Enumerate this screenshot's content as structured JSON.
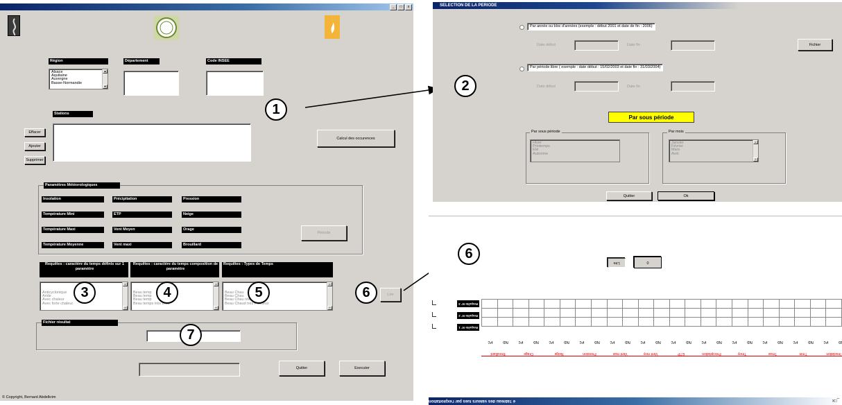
{
  "main_window": {
    "title": "",
    "controls": [
      "_",
      "□",
      "x"
    ],
    "region_label": "Région",
    "region_items": [
      "Alsace",
      "Aquitaine",
      "Auvergne",
      "Basse-Normandie"
    ],
    "department_label": "Département",
    "insee_label": "Code INSEE",
    "stations_label": "Stations",
    "buttons": {
      "effacer": "Effacer",
      "ajouter": "Ajouter",
      "supprimer": "Supprimer",
      "calcul": "Calcul des occurences",
      "periode": "Période",
      "quitter": "Quitter",
      "executer": "Executer",
      "lire": "Lire"
    },
    "params_title": "Paramètres Météorologiques",
    "params": [
      [
        "Insolation",
        "Précipitation",
        "Pression"
      ],
      [
        "Température Mini",
        "ETP",
        "Neige"
      ],
      [
        "Température Maxi",
        "Vent Moyen",
        "Orage"
      ],
      [
        "Température Moyenne",
        "Vent maxi",
        "Brouillard"
      ]
    ],
    "req1_label": "Requêtes : caractère du temps définis sur 1 paramètre",
    "req1_items": [
      "Anticyclonique",
      "Aride",
      "Avec chaleur",
      "Avec forte chaleur"
    ],
    "req2_label": "Requêtes : caractère du temps composition de paramètre",
    "req2_items": [
      "Beau temp",
      "Beau temp",
      "Beau temp",
      "Beau temps très froid"
    ],
    "req3_label": "Requêtes : Types de Temps",
    "req3_items": [
      "Beau Chau",
      "Beau Chau",
      "Beau Chau                 ntieux",
      "Beau Chaud très Pluvieux"
    ],
    "fichier_label": "Fichier résultat",
    "copyright": "© Copyright, Bernard Abdelkrim"
  },
  "annotations": {
    "n1": "1",
    "n2": "2",
    "n3": "3",
    "n4": "4",
    "n5": "5",
    "n6a": "6",
    "n6b": "6",
    "n7": "7"
  },
  "period_window": {
    "title": "SELECTION DE LA PERIODE",
    "option1": "Par année ou bloc d'années (exemple : début 2001 et date de fin : 2006)",
    "option2": "Par période libre ( exemple : date début : 15/02/2003 et date fin : 31/03/2004)",
    "date_debut": "Date début",
    "date_fin": "Date fin",
    "fichier_btn": "Fichier",
    "par_sous_periode_btn": "Par sous période",
    "group_sous_periode": "Par sous période",
    "sous_periode_items": [
      "Hiver",
      "Printemps",
      "Eté",
      "Automne"
    ],
    "group_mois": "Par mois",
    "mois_items": [
      "Janvier",
      "Février",
      "Mars",
      "Avril"
    ],
    "quitter_btn": "Quitter",
    "ok_btn": "Ok"
  },
  "result_window": {
    "title": "e Tableau des valeurs lues par l'exploitation",
    "btn_a": "Lire",
    "btn_b": "0",
    "rows": [
      "Requête N° 3",
      "Requête N° 2",
      "Requête N° 1"
    ],
    "pairs": [
      [
        "Nb",
        "Pc"
      ],
      [
        "Nb",
        "Pc"
      ],
      [
        "Nb",
        "Pc"
      ],
      [
        "Nb",
        "Pc"
      ],
      [
        "Nb",
        "Pc"
      ],
      [
        "Nb",
        "Pc"
      ],
      [
        "Nb",
        "Pc"
      ],
      [
        "Nb",
        "Pc"
      ],
      [
        "Nb",
        "Pc"
      ],
      [
        "Nb",
        "Pc"
      ],
      [
        "Nb",
        "Pc"
      ],
      [
        "Nb",
        "Pc"
      ]
    ],
    "columns": [
      "Insolation",
      "Tmin",
      "Tmax",
      "Tmoy",
      "Précipitation",
      "ETP",
      "Vent moy",
      "Vent max",
      "Pression",
      "Neige",
      "Orage",
      "Brouillard"
    ],
    "controls": "_□x"
  }
}
